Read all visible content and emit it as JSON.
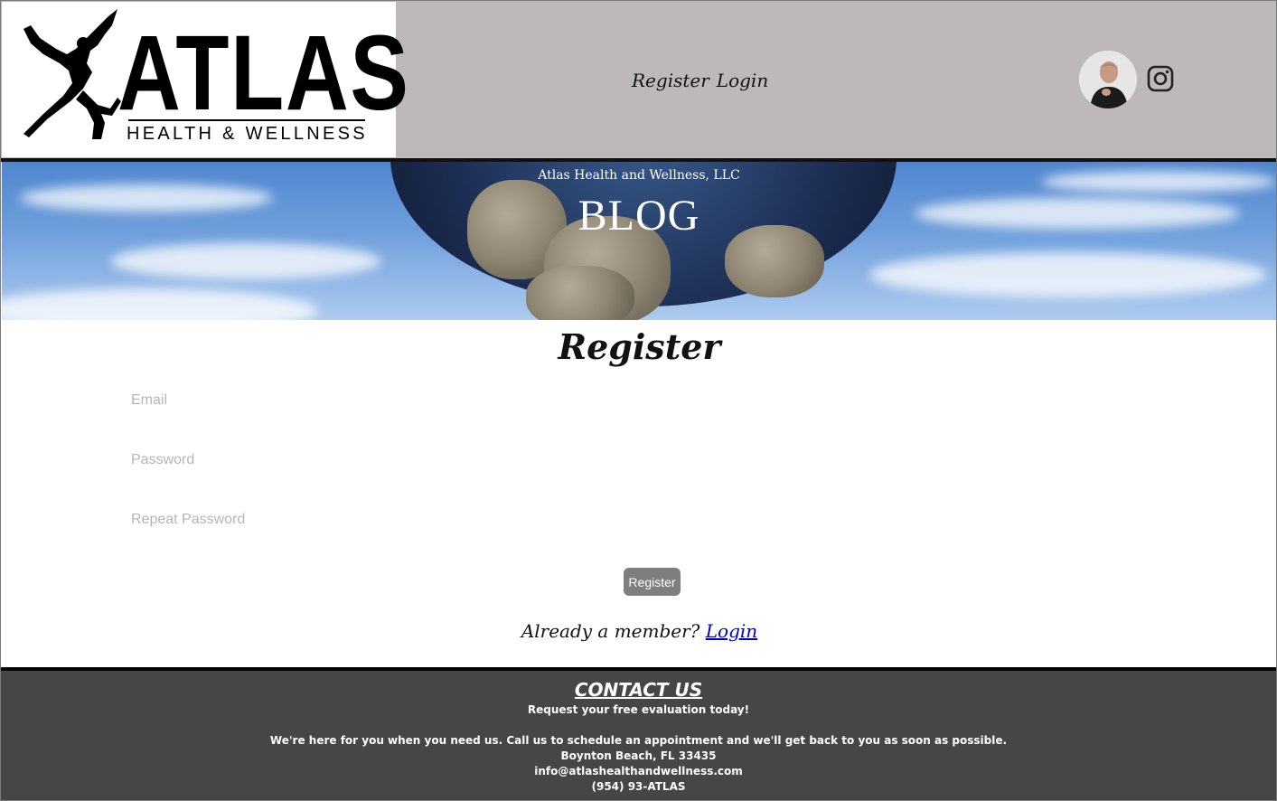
{
  "header": {
    "logo": {
      "word": "ATLAS",
      "subtitle": "HEALTH & WELLNESS"
    },
    "nav": {
      "register_label": "Register",
      "login_label": "Login"
    }
  },
  "hero": {
    "subtitle": "Atlas Health and Wellness, LLC",
    "title": "BLOG"
  },
  "form": {
    "title": "Register",
    "email_placeholder": "Email",
    "password_placeholder": "Password",
    "repeat_password_placeholder": "Repeat Password",
    "submit_label": "Register",
    "member_prompt": "Already a member?",
    "login_link": "Login"
  },
  "footer": {
    "contact_title": "CONTACT US",
    "tagline": "Request your free evaluation today!",
    "message": "We're here for you when you need us. Call us to schedule an appointment and we'll get back to you as soon as possible.",
    "address": "Boynton Beach, FL 33435",
    "email": "info@atlashealthandwellness.com",
    "phone": "(954) 93-ATLAS"
  },
  "colors": {
    "header_bg": "#bcb9b8",
    "footer_bg": "#474647",
    "button_bg": "#7f7f7f",
    "link": "#0000cc"
  },
  "icons": [
    "atlas-figure-icon",
    "instagram-icon"
  ]
}
